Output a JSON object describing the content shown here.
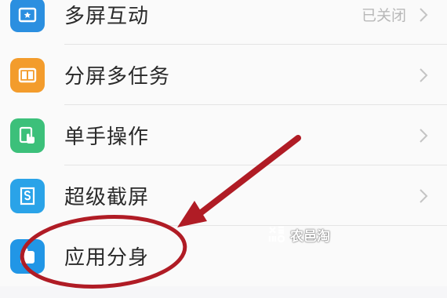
{
  "settings": {
    "items": [
      {
        "label": "多屏互动",
        "status": "已关闭",
        "icon": "multiscreen-icon",
        "color": "#2b8fe0"
      },
      {
        "label": "分屏多任务",
        "status": "",
        "icon": "split-screen-icon",
        "color": "#f39c2c"
      },
      {
        "label": "单手操作",
        "status": "",
        "icon": "one-hand-icon",
        "color": "#3cc07a"
      },
      {
        "label": "超级截屏",
        "status": "",
        "icon": "super-screenshot-icon",
        "color": "#2aa3e8"
      },
      {
        "label": "应用分身",
        "status": "",
        "icon": "app-clone-icon",
        "color": "#2196e6"
      }
    ]
  },
  "annotation": {
    "color": "#b01c25"
  },
  "watermark": {
    "text": "农邑淘"
  }
}
